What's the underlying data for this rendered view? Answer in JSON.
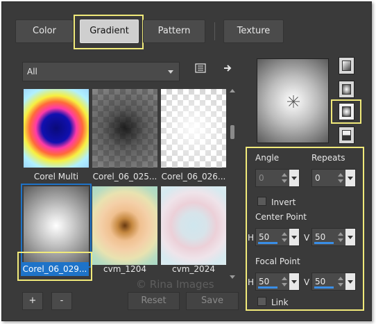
{
  "tabs": [
    {
      "label": "Color"
    },
    {
      "label": "Gradient"
    },
    {
      "label": "Pattern"
    },
    {
      "label": "Texture"
    }
  ],
  "library": {
    "dropdown_value": "All",
    "icons": [
      "list-icon",
      "arrow-right-icon"
    ]
  },
  "gradients": [
    {
      "name": "Corel Multi"
    },
    {
      "name": "Corel_06_025..."
    },
    {
      "name": "Corel_06_026..."
    },
    {
      "name": "Corel_06_029..."
    },
    {
      "name": "cvm_1204"
    },
    {
      "name": "cvm_2024"
    }
  ],
  "buttons": {
    "add": "+",
    "remove": "-",
    "reset": "Reset",
    "save": "Save"
  },
  "params": {
    "angle_label": "Angle",
    "angle_value": "0",
    "repeats_label": "Repeats",
    "repeats_value": "0",
    "invert_label": "Invert",
    "center_label": "Center Point",
    "center_h": "50",
    "center_v": "50",
    "focal_label": "Focal Point",
    "focal_h": "50",
    "focal_v": "50",
    "h": "H",
    "v": "V",
    "link_label": "Link"
  },
  "watermark": "© Rina Images",
  "colors": {
    "panel_bg": "#3a3a3a",
    "highlight": "#f1ea7a",
    "selection": "#1e73c8"
  }
}
